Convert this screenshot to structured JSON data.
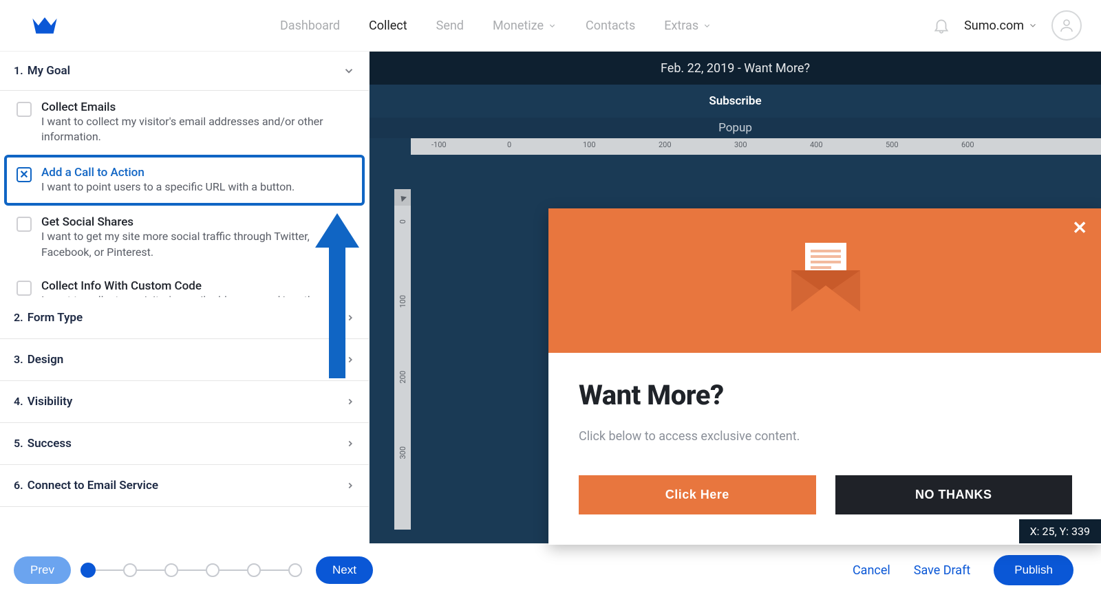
{
  "nav": {
    "items": [
      "Dashboard",
      "Collect",
      "Send",
      "Monetize",
      "Contacts",
      "Extras"
    ],
    "dropdown_idx": [
      3,
      5
    ],
    "active_idx": 1,
    "site": "Sumo.com"
  },
  "sidebar": {
    "sections": [
      {
        "num": "1.",
        "title": "My Goal",
        "open": true
      },
      {
        "num": "2.",
        "title": "Form Type"
      },
      {
        "num": "3.",
        "title": "Design"
      },
      {
        "num": "4.",
        "title": "Visibility"
      },
      {
        "num": "5.",
        "title": "Success"
      },
      {
        "num": "6.",
        "title": "Connect to Email Service"
      }
    ],
    "goals": [
      {
        "title": "Collect Emails",
        "desc": "I want to collect my visitor's email addresses and/or other information."
      },
      {
        "title": "Add a Call to Action",
        "desc": "I want to point users to a specific URL with a button.",
        "selected": true
      },
      {
        "title": "Get Social Shares",
        "desc": "I want to get my site more social traffic through Twitter, Facebook, or Pinterest."
      },
      {
        "title": "Collect Info With Custom Code",
        "desc": "I want to collect my visitor's email addresses and/or other information with custom HTML code."
      }
    ]
  },
  "preview": {
    "title": "Feb. 22, 2019 - Want More?",
    "subtitle": "Subscribe",
    "tab": "Popup",
    "ruler_h": [
      "-100",
      "0",
      "100",
      "200",
      "300",
      "400",
      "500",
      "600"
    ],
    "ruler_v": [
      "0",
      "100",
      "200",
      "300"
    ],
    "coords": "X: 25, Y: 339",
    "popup": {
      "heading": "Want More?",
      "para": "Click below to access exclusive content.",
      "btn1": "Click Here",
      "btn2": "NO THANKS"
    }
  },
  "footer": {
    "prev": "Prev",
    "next": "Next",
    "cancel": "Cancel",
    "save": "Save Draft",
    "publish": "Publish",
    "steps": 6,
    "active_step": 0
  }
}
